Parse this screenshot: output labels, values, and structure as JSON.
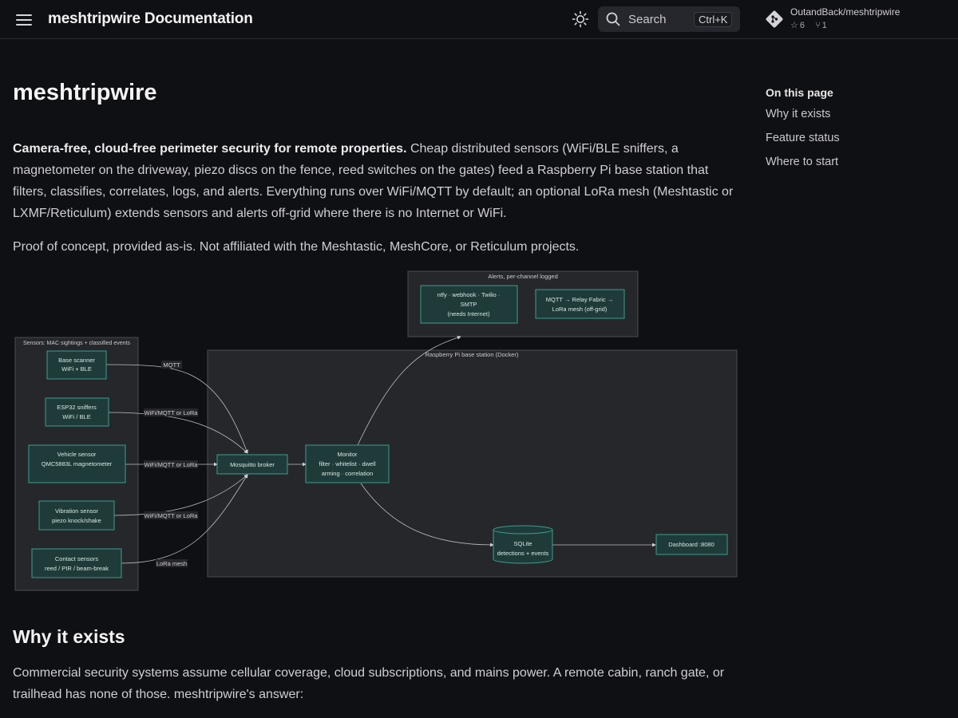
{
  "header": {
    "site_title": "meshtripwire Documentation",
    "search_label": "Search",
    "search_shortcut": "Ctrl+K",
    "repo_name": "OutandBack/meshtripwire",
    "stars": "6",
    "forks": "1",
    "icons": [
      "menu-icon",
      "sun-icon",
      "search-icon",
      "git-icon",
      "star-icon",
      "fork-icon"
    ]
  },
  "main": {
    "title": "meshtripwire",
    "intro_bold": "Camera-free, cloud-free perimeter security for remote properties.",
    "intro_rest": " Cheap distributed sensors (WiFi/BLE sniffers, a magnetometer on the driveway, piezo discs on the fence, reed switches on the gates) feed a Raspberry Pi base station that filters, classifies, correlates, logs, and alerts. Everything runs over WiFi/MQTT by default; an optional LoRa mesh (Meshtastic or LXMF/Reticulum) extends sensors and alerts off-grid where there is no Internet or WiFi.",
    "disclaimer": "Proof of concept, provided as-is. Not affiliated with the Meshtastic, MeshCore, or Reticulum projects.",
    "why_heading": "Why it exists",
    "why_text": "Commercial security systems assume cellular coverage, cloud subscriptions, and mains power. A remote cabin, ranch gate, or trailhead has none of those. meshtripwire's answer:"
  },
  "diagram": {
    "alerts_group": "Alerts, per-channel logged",
    "alerts_ntfy": [
      "ntfy · webhook · Twilio ·",
      "SMTP",
      "(needs Internet)"
    ],
    "alerts_mesh": [
      "MQTT → Relay Fabric →",
      "LoRa mesh (off-grid)"
    ],
    "sensors_group": "Sensors: MAC sightings + classified events",
    "base_group": "Raspberry Pi base station (Docker)",
    "sensors": [
      {
        "lines": [
          "Base scanner",
          "WiFi + BLE"
        ],
        "edge": "MQTT"
      },
      {
        "lines": [
          "ESP32 sniffers",
          "WiFi / BLE"
        ],
        "edge": "WiFi/MQTT or LoRa"
      },
      {
        "lines": [
          "Vehicle sensor",
          "QMC5883L magnetometer"
        ],
        "edge": "WiFi/MQTT or LoRa"
      },
      {
        "lines": [
          "Vibration sensor",
          "piezo knock/shake"
        ],
        "edge": "WiFi/MQTT or LoRa"
      },
      {
        "lines": [
          "Contact sensors",
          "reed / PIR / beam-break"
        ],
        "edge": "LoRa mesh"
      }
    ],
    "broker": "Mosquitto broker",
    "monitor": [
      "Monitor",
      "filter · whitelist · dwell",
      "arming · correlation"
    ],
    "sqlite": [
      "SQLite",
      "detections + events"
    ],
    "dashboard": "Dashboard :8080"
  },
  "toc": {
    "title": "On this page",
    "items": [
      "Why it exists",
      "Feature status",
      "Where to start"
    ]
  }
}
